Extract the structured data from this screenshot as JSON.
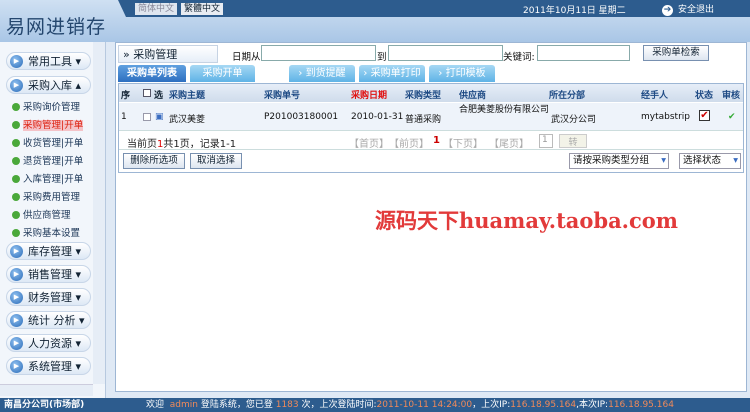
{
  "header": {
    "logo": "易网进销存",
    "lang_simplified": "简体中文",
    "lang_traditional": "繁體中文",
    "date": "2011年10月11日  星期二",
    "logout": "安全退出"
  },
  "sidebar": {
    "groups": [
      "常用工具",
      "采购入库",
      "库存管理",
      "销售管理",
      "财务管理",
      "统计 分析",
      "人力资源",
      "系统管理"
    ],
    "purchase_items": [
      "采购询价管理",
      "采购管理|开单",
      "收货管理|开单",
      "退货管理|开单",
      "入库管理|开单",
      "采购费用管理",
      "供应商管理",
      "采购基本设置"
    ],
    "branch": "南昌分公司(市场部)"
  },
  "main": {
    "title": "采购管理",
    "date_from_label": "日期从",
    "date_to_label": "到",
    "keyword_label": "关键词:",
    "search_button": "采购单检索",
    "tabs": [
      "采购单列表",
      "采购开单",
      "到货提醒",
      "采购单打印",
      "打印模板"
    ],
    "columns": [
      "序",
      "选",
      "采购主题",
      "采购单号",
      "采购日期",
      "采购类型",
      "供应商",
      "所在分部",
      "经手人",
      "状态",
      "审核"
    ],
    "rows": [
      {
        "no": "1",
        "subject": "武汉美菱",
        "order_no": "P201003180001",
        "date": "2010-01-31",
        "type": "普通采购",
        "supplier": "合肥美菱股份有限公司",
        "branch": "武汉分公司",
        "handler": "mytabstrip"
      }
    ],
    "pager": {
      "pre": "当前页",
      "current": "1",
      "post": "共1页，记录1-1",
      "first": "【首页】",
      "prev": "【前页】",
      "page": "1",
      "next": "【下页】",
      "last": "【尾页】",
      "input": "1",
      "go": "转"
    },
    "delete_button": "删除所选项",
    "cancel_button": "取消选择",
    "group_select": "请按采购类型分组",
    "status_select": "选择状态"
  },
  "watermark": "源码天下huamay.taoba.com",
  "footer": {
    "welcome": "欢迎",
    "user": "admin",
    "t1": "登陆系统，您已登",
    "count": "1183",
    "t2": "次，上次登陆时间:",
    "last_time": "2011-10-11 14:24:00",
    "t3": "，上次IP:",
    "last_ip": "116.18.95.164",
    "t4": ",本次IP:",
    "cur_ip": "116.18.95.164"
  }
}
